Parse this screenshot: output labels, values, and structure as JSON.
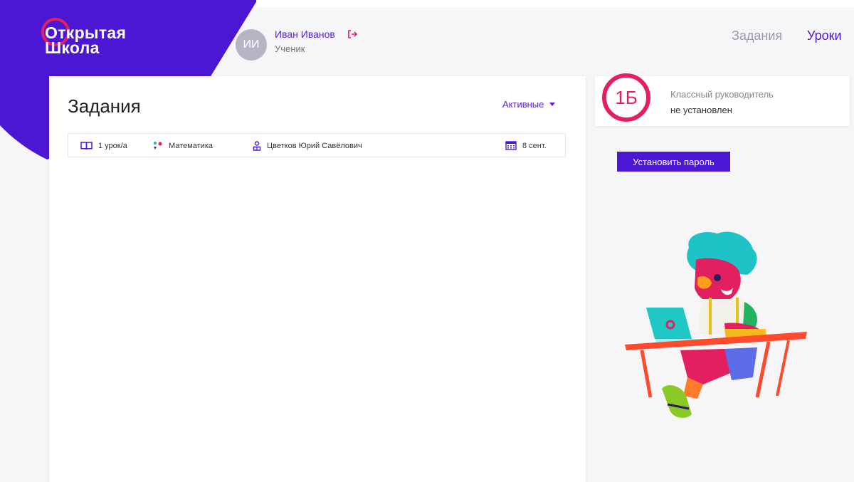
{
  "brand": {
    "line1": "Открытая",
    "line2": "Школа"
  },
  "user": {
    "initials": "ИИ",
    "name": "Иван Иванов",
    "role": "Ученик"
  },
  "nav": {
    "tasks": "Задания",
    "lessons": "Уроки"
  },
  "main": {
    "title": "Задания",
    "filter": "Активные",
    "tasks": [
      {
        "lessons": "1 урок/а",
        "subject": "Математика",
        "teacher": "Цветков Юрий Савёлович",
        "date": "8 сент."
      }
    ]
  },
  "class_info": {
    "class_name": "1Б",
    "teacher_label": "Классный руководитель",
    "teacher_value": "не установлен"
  },
  "actions": {
    "set_password": "Установить пароль"
  },
  "colors": {
    "brand": "#4b17d3",
    "accent": "#e3205f"
  },
  "icons": [
    "logout-icon",
    "book-icon",
    "subject-icon",
    "teacher-icon",
    "calendar-icon",
    "chevron-down-icon"
  ]
}
